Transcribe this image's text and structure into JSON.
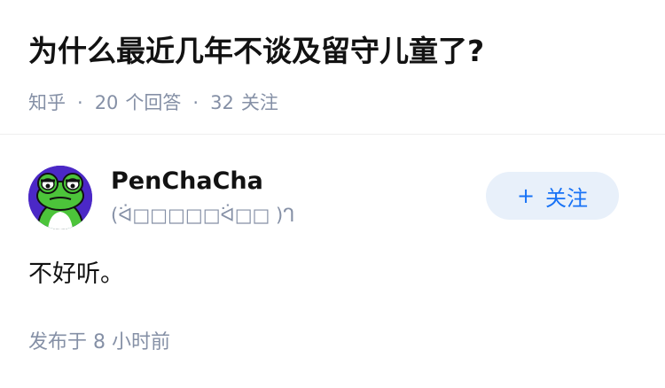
{
  "question": {
    "title": "为什么最近几年不谈及留守儿童了?",
    "source": "知乎",
    "answer_count": "20",
    "answer_count_label": "个回答",
    "follower_count": "32",
    "follower_count_label": "关注",
    "separator": "·"
  },
  "answer": {
    "author": {
      "name": "PenChaCha",
      "headline": "(ᐛ□□□□□ᐛ□□ )ᒉ",
      "follow_label": "关注",
      "follow_icon": "plus-icon"
    },
    "content": "不好听。",
    "published": "发布于 8 小时前"
  },
  "colors": {
    "accent": "#1772f6",
    "follow_bg": "#e8f0fa",
    "meta_text": "#8590a6",
    "avatar_bg": "#4b28c6",
    "frog_green": "#4cc43a"
  }
}
